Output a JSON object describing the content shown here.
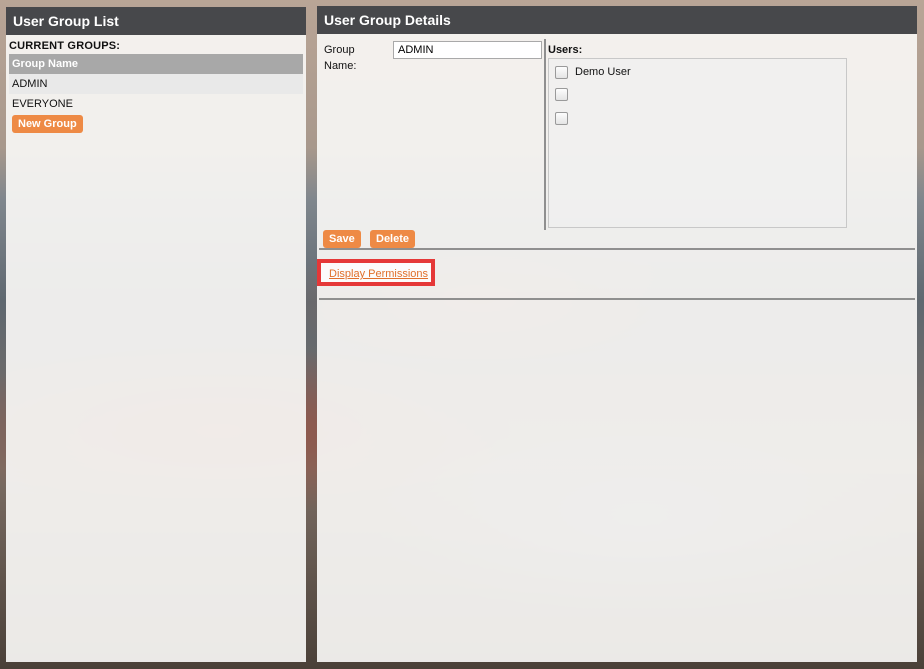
{
  "left_panel": {
    "title": "User Group List",
    "section_label": "CURRENT GROUPS:",
    "table_header": "Group Name",
    "groups": [
      "ADMIN",
      "EVERYONE"
    ],
    "new_group_label": "New Group"
  },
  "right_panel": {
    "title": "User Group Details",
    "group_name_label": "Group Name:",
    "group_name_value": "ADMIN",
    "users_label": "Users:",
    "users": [
      {
        "name": "Demo User",
        "checked": false
      },
      {
        "name": "",
        "checked": false
      },
      {
        "name": "",
        "checked": false
      }
    ],
    "save_label": "Save",
    "delete_label": "Delete",
    "display_permissions_label": "Display Permissions"
  },
  "colors": {
    "header_bg": "#47484b",
    "button_orange": "#ee8a45",
    "link_orange": "#e0702c",
    "highlight_red": "#e53838"
  }
}
